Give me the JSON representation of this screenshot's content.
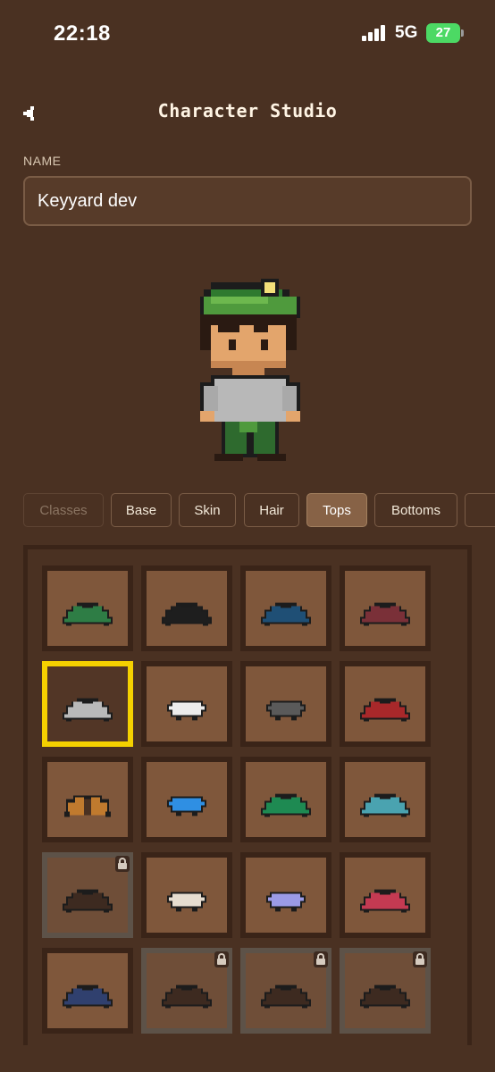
{
  "status": {
    "time": "22:18",
    "network": "5G",
    "battery": "27"
  },
  "header": {
    "title": "Character Studio",
    "back_icon": "chevron-left-icon"
  },
  "name_field": {
    "label": "NAME",
    "value": "Keyyard dev"
  },
  "tabs": [
    {
      "label": "Classes",
      "state": "disabled"
    },
    {
      "label": "Base",
      "state": "normal"
    },
    {
      "label": "Skin",
      "state": "normal"
    },
    {
      "label": "Hair",
      "state": "normal"
    },
    {
      "label": "Tops",
      "state": "active"
    },
    {
      "label": "Bottoms",
      "state": "normal"
    }
  ],
  "tops_grid": [
    {
      "color": "#2e7d45",
      "shape": "sweater",
      "locked": false,
      "selected": false
    },
    {
      "color": "#1e1e1e",
      "shape": "sweater",
      "locked": false,
      "selected": false
    },
    {
      "color": "#1f4f75",
      "shape": "sweater",
      "locked": false,
      "selected": false
    },
    {
      "color": "#7a3038",
      "shape": "sweater",
      "locked": false,
      "selected": false
    },
    {
      "color": "#b9b9b9",
      "shape": "sweater",
      "locked": false,
      "selected": true
    },
    {
      "color": "#ececec",
      "shape": "tee",
      "locked": false,
      "selected": false
    },
    {
      "color": "#5a5a5a",
      "shape": "tee",
      "locked": false,
      "selected": false
    },
    {
      "color": "#a8282a",
      "shape": "sweater",
      "locked": false,
      "selected": false
    },
    {
      "color": "#c07a2e",
      "shape": "jacket",
      "locked": false,
      "selected": false
    },
    {
      "color": "#2f8fe3",
      "shape": "tee",
      "locked": false,
      "selected": false
    },
    {
      "color": "#1e8a52",
      "shape": "sweater",
      "locked": false,
      "selected": false
    },
    {
      "color": "#4aa3b0",
      "shape": "sweater",
      "locked": false,
      "selected": false
    },
    {
      "color": "#3d2a20",
      "shape": "sweater",
      "locked": true,
      "selected": false
    },
    {
      "color": "#e6ddd0",
      "shape": "tee",
      "locked": false,
      "selected": false
    },
    {
      "color": "#9b9be6",
      "shape": "tee",
      "locked": false,
      "selected": false
    },
    {
      "color": "#c43a52",
      "shape": "sweater",
      "locked": false,
      "selected": false
    },
    {
      "color": "#30406e",
      "shape": "sweater",
      "locked": false,
      "selected": false
    },
    {
      "color": "#3d2a20",
      "shape": "sweater",
      "locked": true,
      "selected": false
    },
    {
      "color": "#3d2a20",
      "shape": "sweater",
      "locked": true,
      "selected": false
    },
    {
      "color": "#3d2a20",
      "shape": "sweater",
      "locked": true,
      "selected": false
    }
  ]
}
